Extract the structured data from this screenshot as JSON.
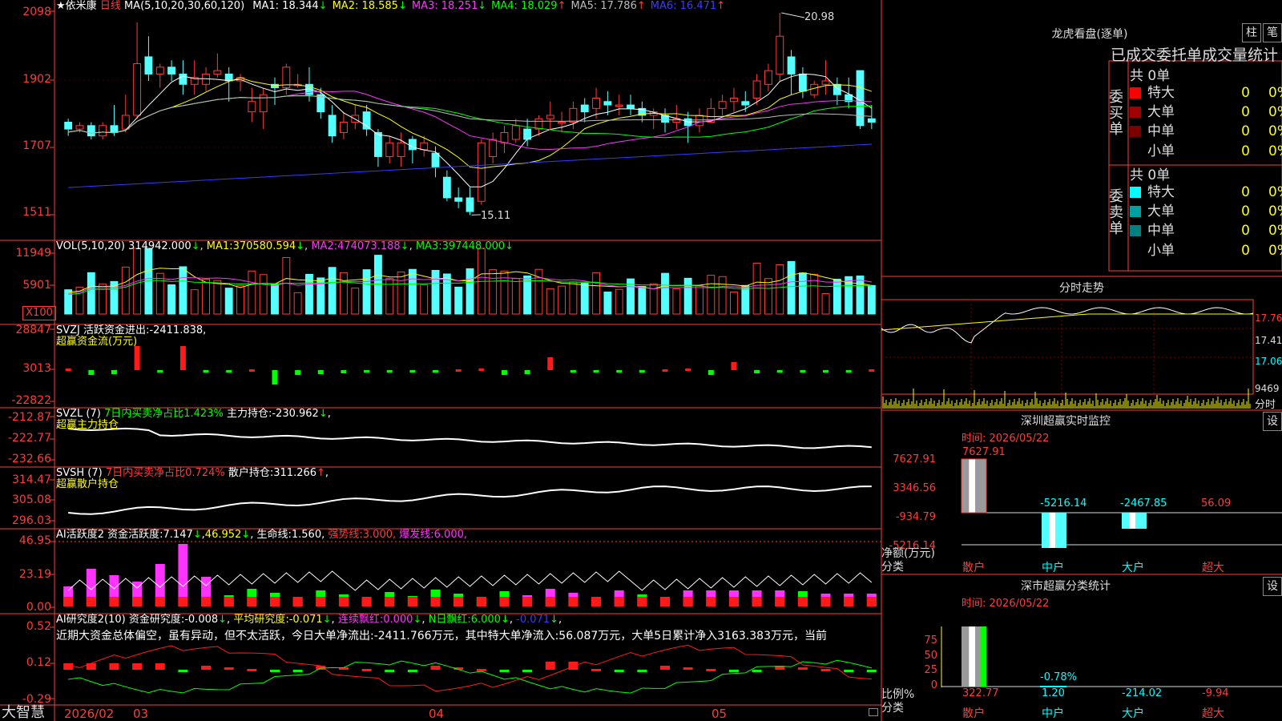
{
  "stock": {
    "star": "★",
    "name": "依米康",
    "period": "日线"
  },
  "kline": {
    "ma_header": "MA(5,10,20,30,60,120)",
    "ma_values": [
      {
        "label": "MA1:",
        "value": "18.344",
        "arrow": "↓",
        "color": "#ffffff"
      },
      {
        "label": "MA2:",
        "value": "18.585",
        "arrow": "↓",
        "color": "#ffff00"
      },
      {
        "label": "MA3:",
        "value": "18.251",
        "arrow": "↓",
        "color": "#ff33ff"
      },
      {
        "label": "MA4:",
        "value": "18.029",
        "arrow": "↑",
        "color": "#00ff00"
      },
      {
        "label": "MA5:",
        "value": "17.786",
        "arrow": "↑",
        "color": "#bbbbbb"
      },
      {
        "label": "MA6:",
        "value": "16.471",
        "arrow": "↑",
        "color": "#3a3aff"
      }
    ],
    "y_labels": [
      "2098",
      "1902",
      "1707",
      "1511"
    ],
    "high_label": "20.98",
    "low_label": "15.11"
  },
  "volume": {
    "header": "VOL(5,10,20)",
    "value": "314942.000",
    "ma1": "370580.594",
    "ma2": "474073.188",
    "ma3": "397448.000",
    "y_labels": [
      "11949",
      "5901"
    ],
    "unit_label": "X100"
  },
  "svzj": {
    "name": "SVZJ",
    "label": "活跃资金进出:",
    "value": "-2411.838",
    "subtitle": "超赢资金流(万元)",
    "y_labels": [
      "28847",
      "3013",
      "-22822"
    ]
  },
  "svzl": {
    "name": "SVZL (7)",
    "ratio_text": "7日内买卖净占比1.423%",
    "hold_label": "主力持仓:",
    "hold_value": "-230.962",
    "subtitle": "超赢主力持仓",
    "y_labels": [
      "-212.87",
      "-222.77",
      "-232.66"
    ]
  },
  "svsh": {
    "name": "SVSH (7)",
    "ratio_text": "7日内买卖净占比0.724%",
    "hold_label": "散户持仓:",
    "hold_value": "311.266",
    "subtitle": "超赢散户持仓",
    "y_labels": [
      "314.47",
      "305.08",
      "296.03"
    ]
  },
  "ai_active": {
    "name": "AI活跃度2",
    "label": "资金活跃度:",
    "value": "7.147",
    "v2": "46.952",
    "life_label": "生命线:",
    "life": "1.560",
    "strong_label": "强势线:",
    "strong": "3.000",
    "burst_label": "爆发线:",
    "burst": "6.000",
    "y_labels": [
      "46.95",
      "23.19",
      "0.00"
    ]
  },
  "ai_research": {
    "name": "AI研究度2(10)",
    "label": "资金研究度:",
    "value": "-0.008",
    "avg_label": "平均研究度:",
    "avg": "-0.071",
    "red_label": "连续飘红:",
    "red": "0.000",
    "nred_label": "N日飘红:",
    "nred": "6.000",
    "last": "-0.071",
    "comment": "近期大资金总体偏空，虽有异动，但不太活跃，今日大单净流出:-2411.766万元，其中特大单净流入:56.087万元，大单5日累计净入3163.383万元，当前",
    "y_labels": [
      "0.52",
      "0.12",
      "-0.29"
    ]
  },
  "bottom_axis": {
    "logo": "大智慧",
    "labels": [
      "2026/02",
      "03",
      "04",
      "05"
    ]
  },
  "dragon_tiger": {
    "title": "龙虎看盘(逐单)",
    "btn_bar": "柱",
    "btn_pen": "笔",
    "table_title": "已成交委托单成交量统计",
    "buy": {
      "side_label": "委买单",
      "total": "共 0单",
      "rows": [
        {
          "label": "特大",
          "count": "0",
          "pct": "0%",
          "color": "#ff0000"
        },
        {
          "label": "大单",
          "count": "0",
          "pct": "0%",
          "color": "#a00000"
        },
        {
          "label": "中单",
          "count": "0",
          "pct": "0%",
          "color": "#7a0000"
        },
        {
          "label": "小单",
          "count": "0",
          "pct": "0%",
          "color": ""
        }
      ]
    },
    "sell": {
      "side_label": "委卖单",
      "total": "共 0单",
      "rows": [
        {
          "label": "特大",
          "count": "0",
          "pct": "0%",
          "color": "#00ffff"
        },
        {
          "label": "大单",
          "count": "0",
          "pct": "0%",
          "color": "#00a0a0"
        },
        {
          "label": "中单",
          "count": "0",
          "pct": "0%",
          "color": "#008080"
        },
        {
          "label": "小单",
          "count": "0",
          "pct": "0%",
          "color": ""
        }
      ]
    }
  },
  "intraday": {
    "title": "分时走势",
    "y_labels": [
      "17.76",
      "17.41",
      "17.06"
    ],
    "vol_label": "9469",
    "bottom_label": "分时"
  },
  "sz_monitor": {
    "title": "深圳超赢实时监控",
    "settings_btn": "设",
    "time": "时间: 2026/05/22",
    "y_labels": [
      "7627.91",
      "3346.56",
      "-934.79",
      "-5216.14"
    ],
    "unit": "净额(万元)",
    "cat_label": "分类",
    "categories": [
      "散户",
      "中户",
      "大户",
      "超大"
    ],
    "values": [
      "7627.91",
      "-5216.14",
      "-2467.85",
      "56.09"
    ]
  },
  "sz_class": {
    "title": "深市超赢分类统计",
    "settings_btn": "设",
    "time": "时间: 2026/05/22",
    "y_labels": [
      "75",
      "50",
      "25",
      "0"
    ],
    "unit": "比例%",
    "cat_label": "分类",
    "categories": [
      "散户",
      "中户",
      "大户",
      "超大"
    ],
    "values": [
      "322.77",
      "1.20",
      "-214.02",
      "-9.94"
    ],
    "mid_label": "-0.78%"
  },
  "chart_data": {
    "type": "candlestick",
    "x_labels": [
      "2026/02",
      "03",
      "04",
      "05"
    ],
    "ohlc_note": "daily candles, values in CNY",
    "candles": [
      [
        17.8,
        17.6,
        17.9,
        17.4
      ],
      [
        17.6,
        17.7,
        17.8,
        17.5
      ],
      [
        17.7,
        17.4,
        17.8,
        17.3
      ],
      [
        17.4,
        17.7,
        17.8,
        17.3
      ],
      [
        17.7,
        17.5,
        18.3,
        17.4
      ],
      [
        17.6,
        18.0,
        18.6,
        17.5
      ],
      [
        18.0,
        19.5,
        20.7,
        17.9
      ],
      [
        19.7,
        19.2,
        20.3,
        19.0
      ],
      [
        19.2,
        19.4,
        19.5,
        18.8
      ],
      [
        19.4,
        19.2,
        19.6,
        19.0
      ],
      [
        19.2,
        18.9,
        19.6,
        18.6
      ],
      [
        18.9,
        19.1,
        19.6,
        18.6
      ],
      [
        18.9,
        19.2,
        19.4,
        18.7
      ],
      [
        19.2,
        19.3,
        19.8,
        19.1
      ],
      [
        19.2,
        19.0,
        19.4,
        18.4
      ],
      [
        19.0,
        19.1,
        19.2,
        18.7
      ],
      [
        18.1,
        18.4,
        18.8,
        17.8
      ],
      [
        18.1,
        18.6,
        18.8,
        17.6
      ],
      [
        18.9,
        18.8,
        19.1,
        18.3
      ],
      [
        18.8,
        19.4,
        19.5,
        18.6
      ],
      [
        18.9,
        18.9,
        19.2,
        18.8
      ],
      [
        18.9,
        18.6,
        19.4,
        18.4
      ],
      [
        18.6,
        18.1,
        18.8,
        17.9
      ],
      [
        18.0,
        17.4,
        18.3,
        17.2
      ],
      [
        17.5,
        17.8,
        18.1,
        17.3
      ],
      [
        17.8,
        18.0,
        18.3,
        17.6
      ],
      [
        18.1,
        17.6,
        18.3,
        17.4
      ],
      [
        17.5,
        16.8,
        17.6,
        16.5
      ],
      [
        16.8,
        17.2,
        17.4,
        16.6
      ],
      [
        16.8,
        17.2,
        17.5,
        16.5
      ],
      [
        17.3,
        17.0,
        17.4,
        16.6
      ],
      [
        17.0,
        17.2,
        17.4,
        16.8
      ],
      [
        16.9,
        16.5,
        17.1,
        16.2
      ],
      [
        16.2,
        15.6,
        16.4,
        15.5
      ],
      [
        15.6,
        15.5,
        15.9,
        15.3
      ],
      [
        15.6,
        15.2,
        15.9,
        15.1
      ],
      [
        15.5,
        17.2,
        17.3,
        15.4
      ],
      [
        16.8,
        17.3,
        17.5,
        16.6
      ],
      [
        17.2,
        17.5,
        17.7,
        16.9
      ],
      [
        17.3,
        17.7,
        17.9,
        17.2
      ],
      [
        17.6,
        17.3,
        17.9,
        17.1
      ],
      [
        17.6,
        17.9,
        18.0,
        17.4
      ],
      [
        17.9,
        18.0,
        18.4,
        17.6
      ],
      [
        17.8,
        17.8,
        18.1,
        17.5
      ],
      [
        17.8,
        18.2,
        18.4,
        17.6
      ],
      [
        18.3,
        18.1,
        18.5,
        17.8
      ],
      [
        18.2,
        18.5,
        18.8,
        17.9
      ],
      [
        18.4,
        18.3,
        18.7,
        18.0
      ],
      [
        18.3,
        18.3,
        18.6,
        18.0
      ],
      [
        18.3,
        18.2,
        18.6,
        18.0
      ],
      [
        18.2,
        18.0,
        18.4,
        17.8
      ],
      [
        18.0,
        18.1,
        18.2,
        17.6
      ],
      [
        18.0,
        17.8,
        18.2,
        17.5
      ],
      [
        17.8,
        17.9,
        18.3,
        17.6
      ],
      [
        17.9,
        17.7,
        18.1,
        17.2
      ],
      [
        17.7,
        18.0,
        18.2,
        17.5
      ],
      [
        17.8,
        18.2,
        18.5,
        17.8
      ],
      [
        18.2,
        18.4,
        18.6,
        18.0
      ],
      [
        18.4,
        18.5,
        18.8,
        18.1
      ],
      [
        18.4,
        18.3,
        18.7,
        18.1
      ],
      [
        18.5,
        19.0,
        19.2,
        18.3
      ],
      [
        18.9,
        19.3,
        19.5,
        18.7
      ],
      [
        19.2,
        20.3,
        20.98,
        19.0
      ],
      [
        19.7,
        19.2,
        19.9,
        18.6
      ],
      [
        19.2,
        18.7,
        19.4,
        18.5
      ],
      [
        18.6,
        18.9,
        19.0,
        18.5
      ],
      [
        18.9,
        19.0,
        19.6,
        18.6
      ],
      [
        18.9,
        18.6,
        19.1,
        18.3
      ],
      [
        18.6,
        18.4,
        19.1,
        18.2
      ],
      [
        19.3,
        17.7,
        19.3,
        17.6
      ],
      [
        17.9,
        17.8,
        18.3,
        17.6
      ]
    ]
  }
}
